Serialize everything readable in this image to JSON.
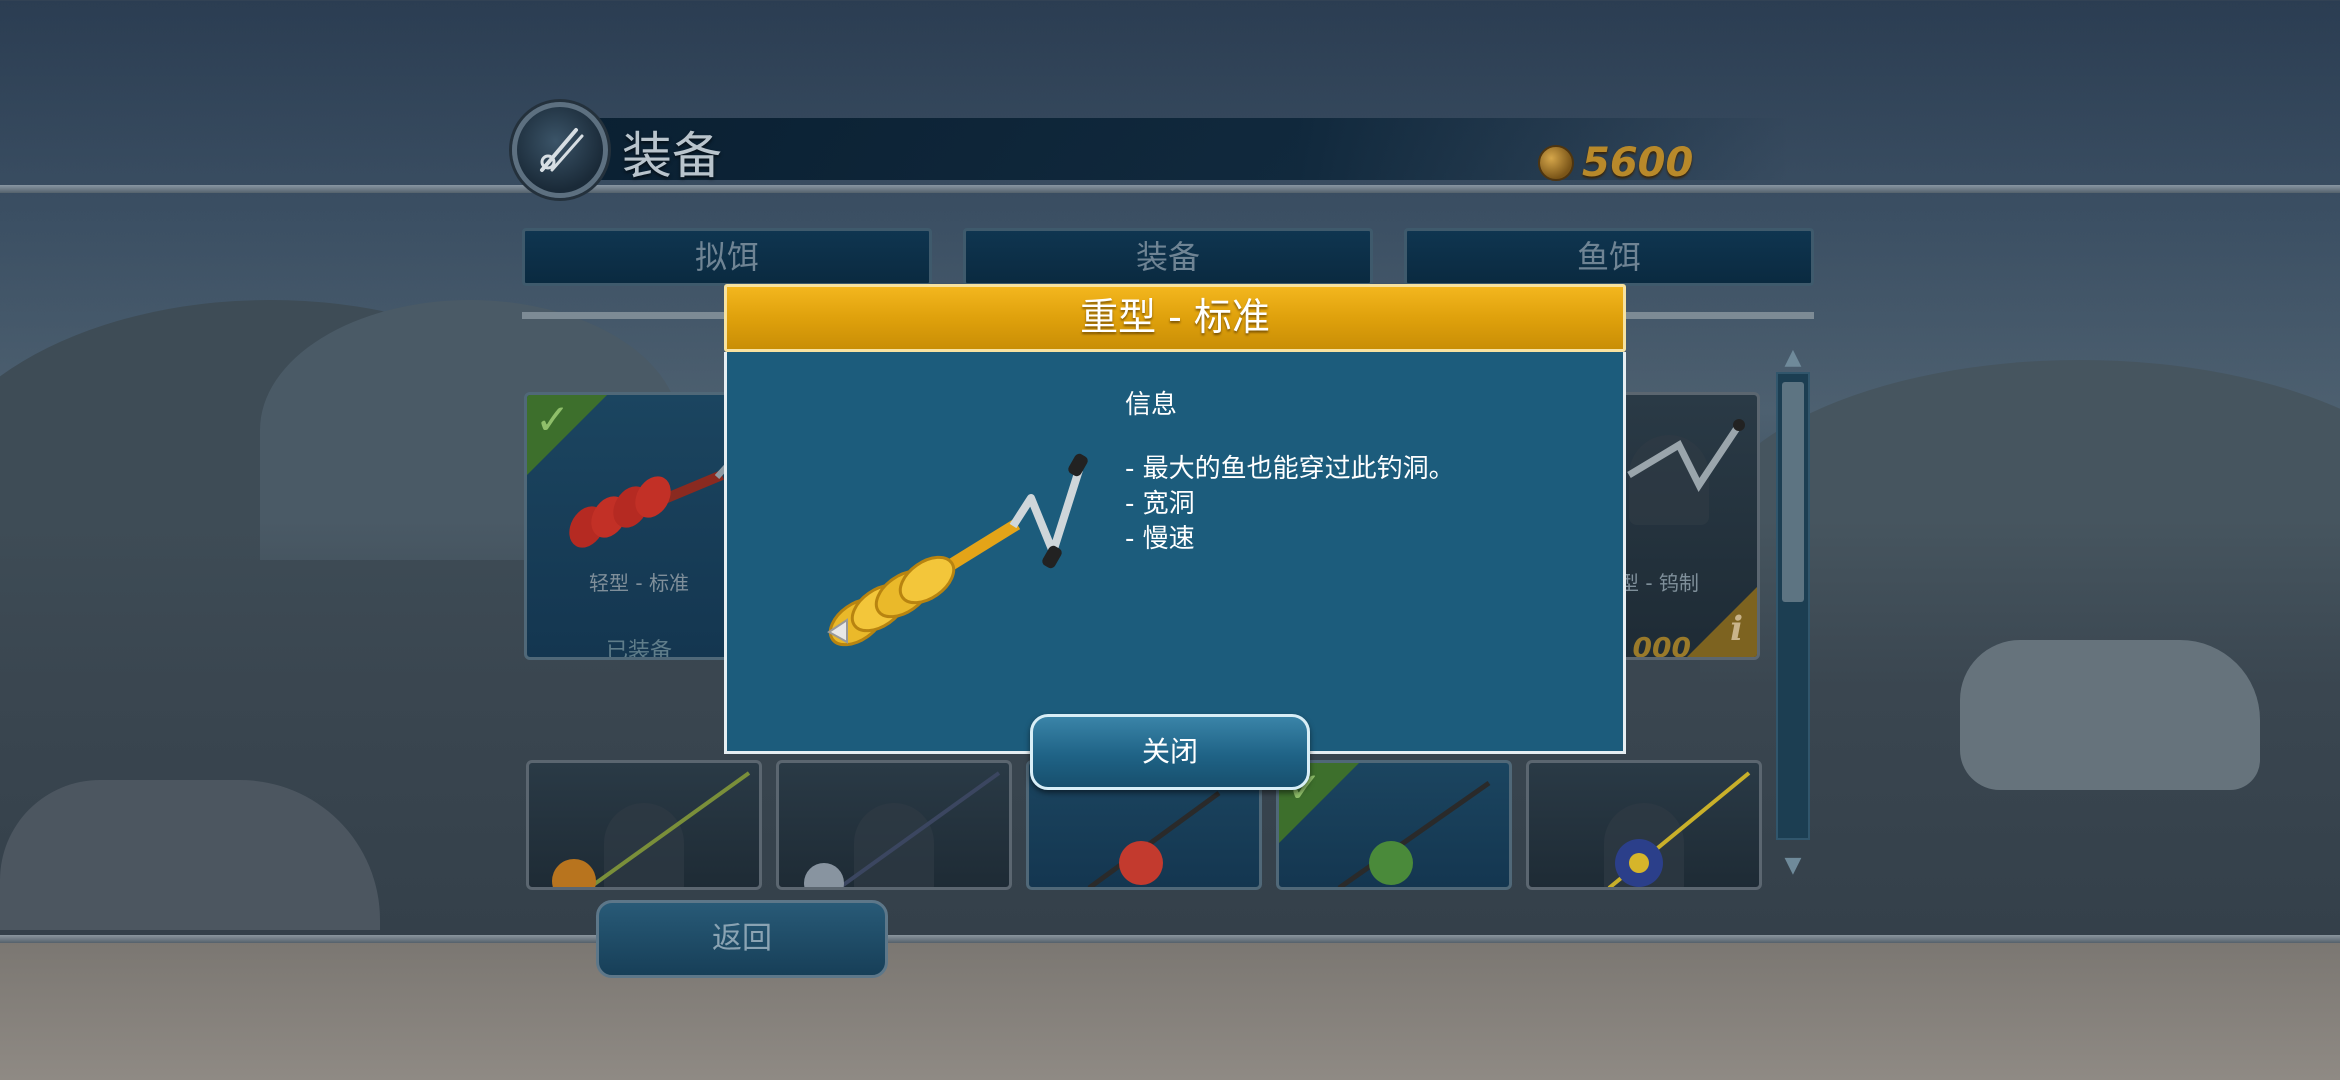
{
  "header": {
    "title": "装备",
    "coins": "5600"
  },
  "tabs": [
    {
      "label": "拟饵"
    },
    {
      "label": "装备"
    },
    {
      "label": "鱼饵"
    }
  ],
  "cards": [
    {
      "name": "轻型 - 标准",
      "status": "已装备"
    },
    {
      "name": "型 - 钨制",
      "price": "000"
    }
  ],
  "modal": {
    "title": "重型 - 标准",
    "info_heading": "信息",
    "info_lines": [
      "- 最大的鱼也能穿过此钓洞。",
      "- 宽洞",
      "- 慢速"
    ],
    "close_label": "关闭"
  },
  "back_label": "返回"
}
